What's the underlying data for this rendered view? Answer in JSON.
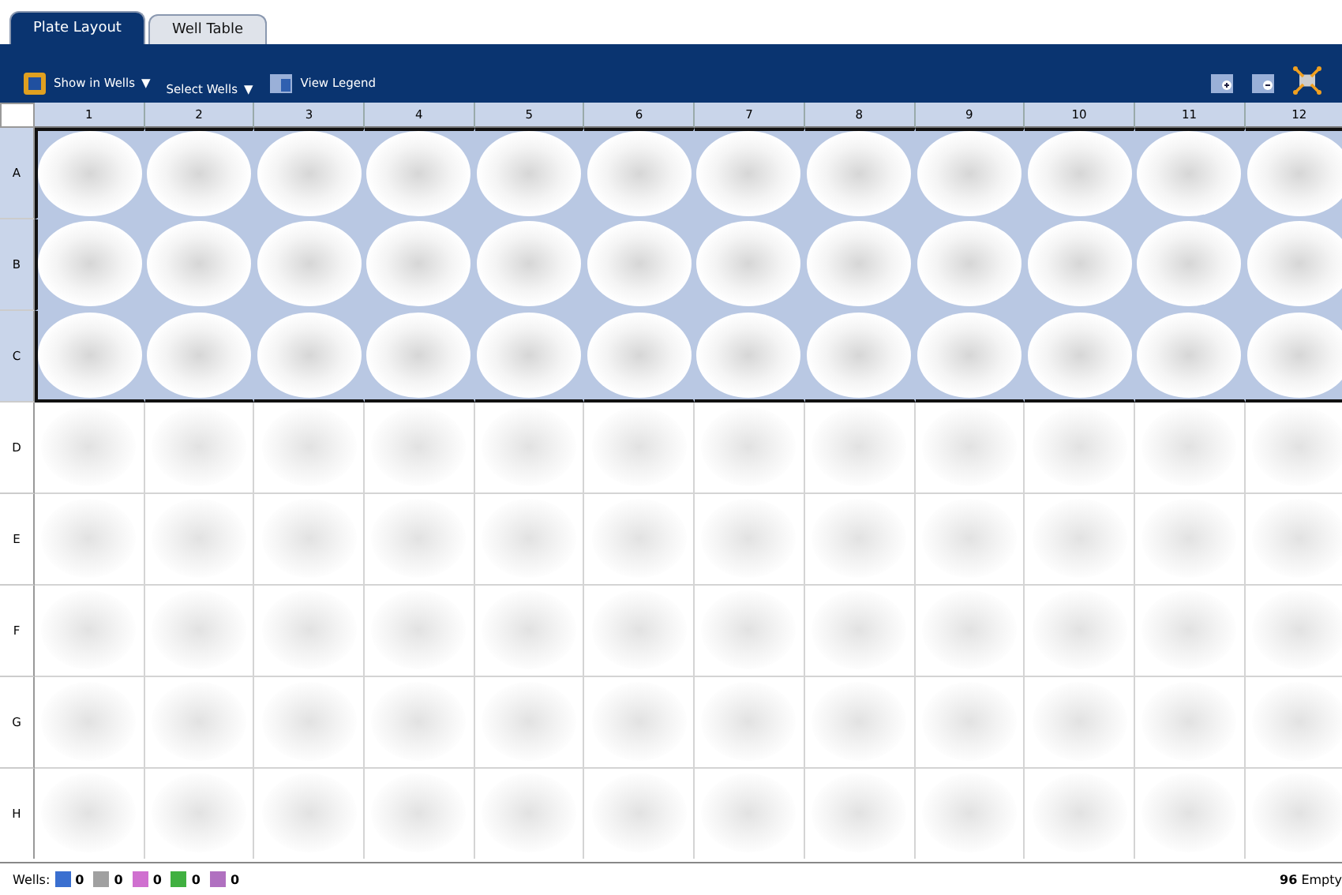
{
  "tabs": [
    {
      "label": "Plate Layout",
      "selected": true
    },
    {
      "label": "Well Table",
      "selected": false
    }
  ],
  "toolbar": {
    "items": [
      {
        "kind": "dropdown",
        "label": "Show in Wells",
        "arrow": "▼"
      },
      {
        "kind": "dropdown",
        "label": "Select Wells",
        "arrow": "▼"
      },
      {
        "kind": "button",
        "label": "View Legend"
      }
    ]
  },
  "plate": {
    "columns": [
      "1",
      "2",
      "3",
      "4",
      "5",
      "6",
      "7",
      "8",
      "9",
      "10",
      "11",
      "12"
    ],
    "rows": [
      {
        "label": "A",
        "selected": true
      },
      {
        "label": "B",
        "selected": true
      },
      {
        "label": "C",
        "selected": true
      },
      {
        "label": "D",
        "selected": false
      },
      {
        "label": "E",
        "selected": false
      },
      {
        "label": "F",
        "selected": false
      },
      {
        "label": "G",
        "selected": false
      },
      {
        "label": "H",
        "selected": false
      }
    ]
  },
  "status_bar": {
    "label": "Wells:",
    "legend": [
      {
        "color": "#3a6fd0",
        "count": "0"
      },
      {
        "color": "#a0a0a0",
        "count": "0"
      },
      {
        "color": "#d070d0",
        "count": "0"
      },
      {
        "color": "#40b040",
        "count": "0"
      },
      {
        "color": "#b070c0",
        "count": "0"
      }
    ],
    "summary": "**96** Empty"
  }
}
